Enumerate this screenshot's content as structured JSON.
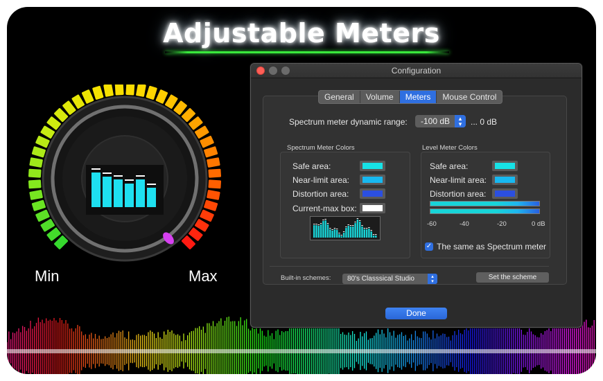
{
  "headline": "Adjustable Meters",
  "meter_dial": {
    "min_label": "Min",
    "max_label": "Max",
    "segment_colors": [
      "#36d92e",
      "#7ee81f",
      "#c8ec13",
      "#f4e400",
      "#ffd500",
      "#ff9b00",
      "#ff5a00",
      "#ff1a12"
    ],
    "knob_indicator_color": "#d640f0"
  },
  "window": {
    "title": "Configuration",
    "tabs": [
      {
        "label": "General",
        "active": false
      },
      {
        "label": "Volume",
        "active": false
      },
      {
        "label": "Meters",
        "active": true
      },
      {
        "label": "Mouse Control",
        "active": false
      }
    ],
    "dynamic_range": {
      "label": "Spectrum meter dynamic range:",
      "value": "-100 dB",
      "suffix": "... 0 dB"
    },
    "spectrum_colors": {
      "title": "Spectrum Meter Colors",
      "rows": [
        {
          "label": "Safe area:",
          "color": "#17e2e6"
        },
        {
          "label": "Near-limit area:",
          "color": "#17b8f0"
        },
        {
          "label": "Distortion area:",
          "color": "#2b4fe0"
        },
        {
          "label": "Current-max box:",
          "color": "#ffffff"
        }
      ]
    },
    "level_colors": {
      "title": "Level Meter Colors",
      "rows": [
        {
          "label": "Safe area:",
          "color": "#17e2e6"
        },
        {
          "label": "Near-limit area:",
          "color": "#17b8f0"
        },
        {
          "label": "Distortion area:",
          "color": "#2b4fe0"
        }
      ],
      "scale": [
        "-60",
        "-40",
        "-20",
        "0 dB"
      ],
      "same_as_spectrum_label": "The same as Spectrum meter",
      "same_as_spectrum_checked": true
    },
    "schemes": {
      "label": "Built-in schemes:",
      "value": "80's Classsical Studio",
      "set_button": "Set the scheme"
    },
    "done_button": "Done"
  }
}
